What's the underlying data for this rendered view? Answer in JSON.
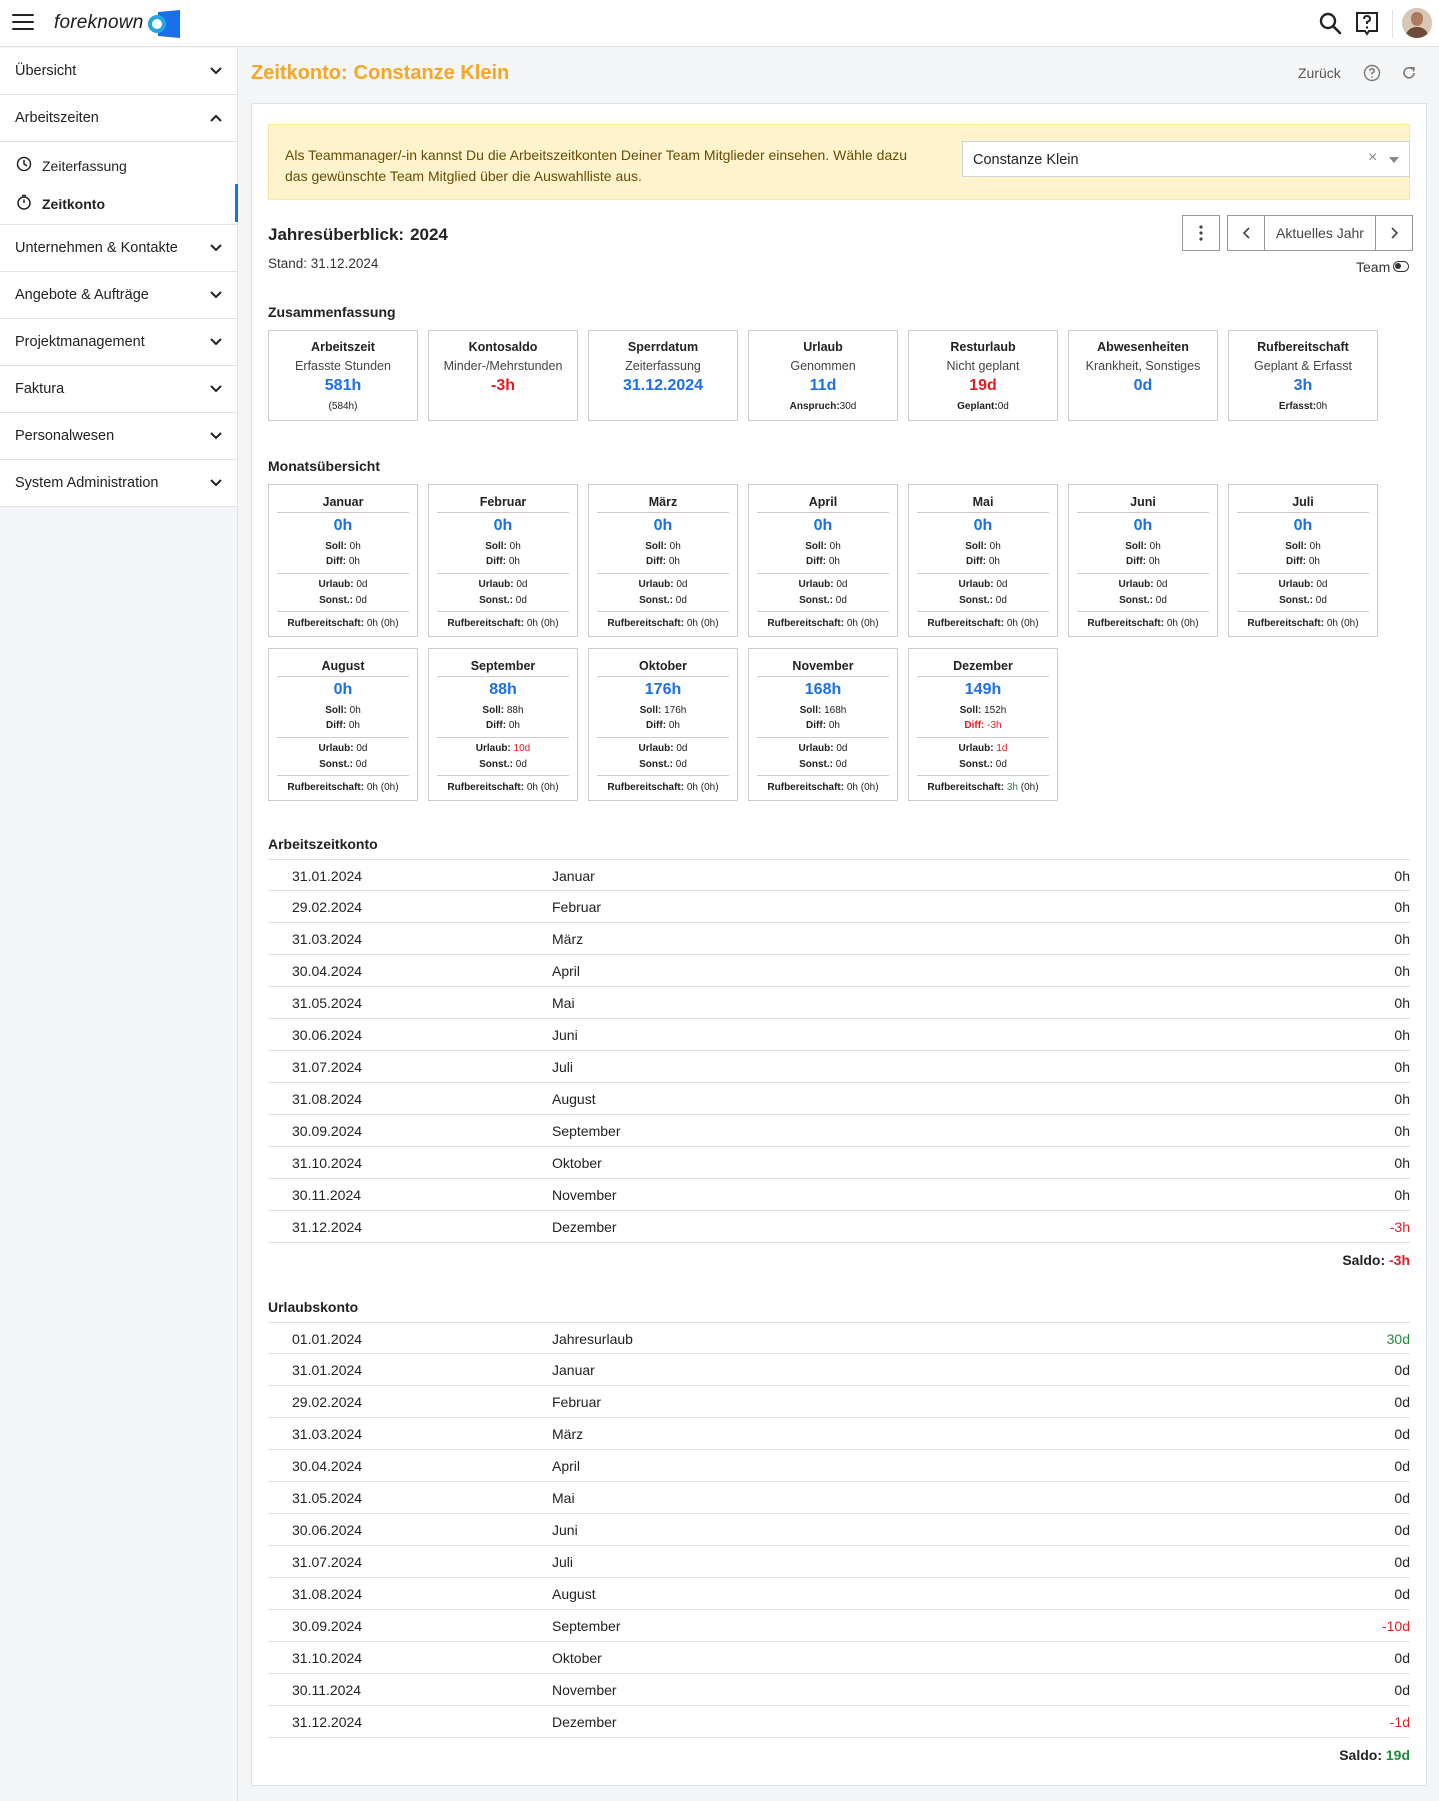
{
  "app": {
    "logo": "foreknown"
  },
  "sidebar": {
    "overview": "Übersicht",
    "worktime": "Arbeitszeiten",
    "sub": [
      "Zeiterfassung",
      "Zeitkonto"
    ],
    "groups": [
      "Unternehmen & Kontakte",
      "Angebote & Aufträge",
      "Projektmanagement",
      "Faktura",
      "Personalwesen",
      "System Administration"
    ]
  },
  "header": {
    "title": "Zeitkonto:",
    "name": "Constanze Klein",
    "back": "Zurück"
  },
  "alert": {
    "text": "Als Teammanager/-in kannst Du die Arbeitszeitkonten Deiner Team Mitglieder einsehen. Wähle dazu das gewünschte Team Mitglied über die Auswahlliste aus."
  },
  "member_select": {
    "value": "Constanze Klein",
    "clear": "×"
  },
  "year": {
    "label": "Jahresüberblick:",
    "value": "2024",
    "stand": "Stand: 31.12.2024",
    "current_btn": "Aktuelles Jahr",
    "team": "Team"
  },
  "sections": {
    "summary": "Zusammenfassung",
    "months": "Monatsübersicht",
    "worktime_account": "Arbeitszeitkonto",
    "vacation_account": "Urlaubskonto"
  },
  "summary": [
    {
      "title": "Arbeitszeit",
      "sub": "Erfasste Stunden",
      "value": "581h",
      "foot_label": "",
      "foot_value": "(584h)"
    },
    {
      "title": "Kontosaldo",
      "sub": "Minder-/Mehrstunden",
      "value": "-3h",
      "foot_label": "",
      "foot_value": ""
    },
    {
      "title": "Sperrdatum",
      "sub": "Zeiterfassung",
      "value": "31.12.2024",
      "foot_label": "",
      "foot_value": ""
    },
    {
      "title": "Urlaub",
      "sub": "Genommen",
      "value": "11d",
      "foot_label": "Anspruch:",
      "foot_value": "30d"
    },
    {
      "title": "Resturlaub",
      "sub": "Nicht geplant",
      "value": "19d",
      "foot_label": "Geplant:",
      "foot_value": "0d"
    },
    {
      "title": "Abwesenheiten",
      "sub": "Krankheit, Sonstiges",
      "value": "0d",
      "foot_label": "",
      "foot_value": ""
    },
    {
      "title": "Rufbereitschaft",
      "sub": "Geplant & Erfasst",
      "value": "3h",
      "foot_label": "Erfasst:",
      "foot_value": "0h"
    }
  ],
  "month_labels": {
    "soll": "Soll:",
    "diff": "Diff:",
    "urlaub": "Urlaub:",
    "sonst": "Sonst.:",
    "ruf": "Rufbereitschaft:"
  },
  "months": [
    {
      "name": "Januar",
      "value": "0h",
      "soll": "0h",
      "diff": "0h",
      "urlaub": "0d",
      "sonst": "0d",
      "ruf": "0h",
      "ruf_extra": "(0h)"
    },
    {
      "name": "Februar",
      "value": "0h",
      "soll": "0h",
      "diff": "0h",
      "urlaub": "0d",
      "sonst": "0d",
      "ruf": "0h",
      "ruf_extra": "(0h)"
    },
    {
      "name": "März",
      "value": "0h",
      "soll": "0h",
      "diff": "0h",
      "urlaub": "0d",
      "sonst": "0d",
      "ruf": "0h",
      "ruf_extra": "(0h)"
    },
    {
      "name": "April",
      "value": "0h",
      "soll": "0h",
      "diff": "0h",
      "urlaub": "0d",
      "sonst": "0d",
      "ruf": "0h",
      "ruf_extra": "(0h)"
    },
    {
      "name": "Mai",
      "value": "0h",
      "soll": "0h",
      "diff": "0h",
      "urlaub": "0d",
      "sonst": "0d",
      "ruf": "0h",
      "ruf_extra": "(0h)"
    },
    {
      "name": "Juni",
      "value": "0h",
      "soll": "0h",
      "diff": "0h",
      "urlaub": "0d",
      "sonst": "0d",
      "ruf": "0h",
      "ruf_extra": "(0h)"
    },
    {
      "name": "Juli",
      "value": "0h",
      "soll": "0h",
      "diff": "0h",
      "urlaub": "0d",
      "sonst": "0d",
      "ruf": "0h",
      "ruf_extra": "(0h)"
    },
    {
      "name": "August",
      "value": "0h",
      "soll": "0h",
      "diff": "0h",
      "urlaub": "0d",
      "sonst": "0d",
      "ruf": "0h",
      "ruf_extra": "(0h)"
    },
    {
      "name": "September",
      "value": "88h",
      "soll": "88h",
      "diff": "0h",
      "urlaub": "10d",
      "sonst": "0d",
      "ruf": "0h",
      "ruf_extra": "(0h)"
    },
    {
      "name": "Oktober",
      "value": "176h",
      "soll": "176h",
      "diff": "0h",
      "urlaub": "0d",
      "sonst": "0d",
      "ruf": "0h",
      "ruf_extra": "(0h)"
    },
    {
      "name": "November",
      "value": "168h",
      "soll": "168h",
      "diff": "0h",
      "urlaub": "0d",
      "sonst": "0d",
      "ruf": "0h",
      "ruf_extra": "(0h)"
    },
    {
      "name": "Dezember",
      "value": "149h",
      "soll": "152h",
      "diff": "-3h",
      "urlaub": "1d",
      "sonst": "0d",
      "ruf": "3h",
      "ruf_extra": "(0h)"
    }
  ],
  "worktime_rows": [
    {
      "date": "31.01.2024",
      "label": "Januar",
      "value": "0h"
    },
    {
      "date": "29.02.2024",
      "label": "Februar",
      "value": "0h"
    },
    {
      "date": "31.03.2024",
      "label": "März",
      "value": "0h"
    },
    {
      "date": "30.04.2024",
      "label": "April",
      "value": "0h"
    },
    {
      "date": "31.05.2024",
      "label": "Mai",
      "value": "0h"
    },
    {
      "date": "30.06.2024",
      "label": "Juni",
      "value": "0h"
    },
    {
      "date": "31.07.2024",
      "label": "Juli",
      "value": "0h"
    },
    {
      "date": "31.08.2024",
      "label": "August",
      "value": "0h"
    },
    {
      "date": "30.09.2024",
      "label": "September",
      "value": "0h"
    },
    {
      "date": "31.10.2024",
      "label": "Oktober",
      "value": "0h"
    },
    {
      "date": "30.11.2024",
      "label": "November",
      "value": "0h"
    },
    {
      "date": "31.12.2024",
      "label": "Dezember",
      "value": "-3h"
    }
  ],
  "worktime_saldo": {
    "label": "Saldo:",
    "value": "-3h"
  },
  "vacation_rows": [
    {
      "date": "01.01.2024",
      "label": "Jahresurlaub",
      "value": "30d"
    },
    {
      "date": "31.01.2024",
      "label": "Januar",
      "value": "0d"
    },
    {
      "date": "29.02.2024",
      "label": "Februar",
      "value": "0d"
    },
    {
      "date": "31.03.2024",
      "label": "März",
      "value": "0d"
    },
    {
      "date": "30.04.2024",
      "label": "April",
      "value": "0d"
    },
    {
      "date": "31.05.2024",
      "label": "Mai",
      "value": "0d"
    },
    {
      "date": "30.06.2024",
      "label": "Juni",
      "value": "0d"
    },
    {
      "date": "31.07.2024",
      "label": "Juli",
      "value": "0d"
    },
    {
      "date": "31.08.2024",
      "label": "August",
      "value": "0d"
    },
    {
      "date": "30.09.2024",
      "label": "September",
      "value": "-10d"
    },
    {
      "date": "31.10.2024",
      "label": "Oktober",
      "value": "0d"
    },
    {
      "date": "30.11.2024",
      "label": "November",
      "value": "0d"
    },
    {
      "date": "31.12.2024",
      "label": "Dezember",
      "value": "-1d"
    }
  ],
  "vacation_saldo": {
    "label": "Saldo:",
    "value": "19d"
  },
  "colors": {
    "accent": "#f5a623",
    "blue": "#1b6fe8",
    "red": "#e31b23",
    "green": "#1e8a3c"
  }
}
